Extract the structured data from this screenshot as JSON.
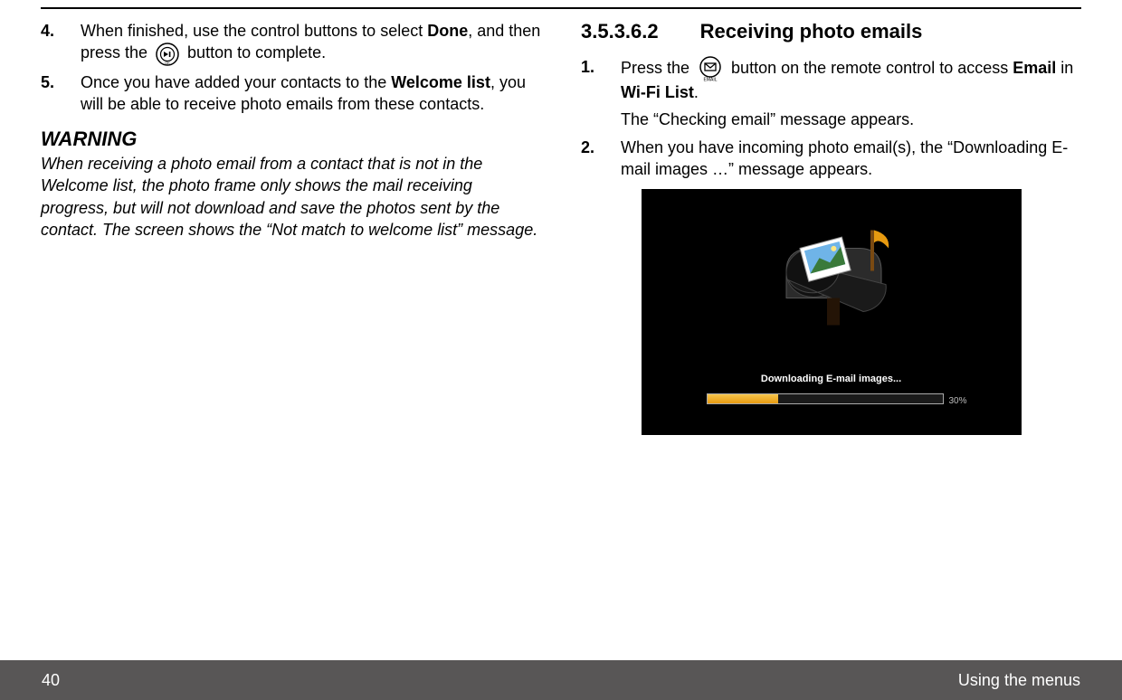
{
  "left": {
    "steps": [
      {
        "num": "4.",
        "pre": "When finished, use the control buttons to select ",
        "bold1": "Done",
        "mid1": ", and then press the ",
        "icon": "ok",
        "post1": " button to complete."
      },
      {
        "num": "5.",
        "pre": "Once you have added your contacts to the ",
        "bold1": "Welcome list",
        "post1": ", you will be able to receive photo emails from these contacts."
      }
    ],
    "warning_head": "WARNING",
    "warning_body": "When receiving a photo email from a contact that is not in the Welcome list, the photo frame only shows the mail receiving progress, but will not download and save the photos sent by the contact. The screen shows the “Not match to welcome list” message."
  },
  "right": {
    "section_num": "3.5.3.6.2",
    "section_title": "Receiving photo emails",
    "steps": [
      {
        "num": "1.",
        "pre": "Press the ",
        "icon": "email",
        "mid1": " button on the remote control to access ",
        "bold1": "Email",
        "mid2": " in ",
        "bold2": "Wi-Fi List",
        "post1": ".",
        "line2": "The “Checking email” message appears."
      },
      {
        "num": "2.",
        "pre": "When you have incoming photo email(s), the “Downloading E-mail images …” message appears."
      }
    ],
    "screenshot": {
      "caption": "Downloading E-mail images...",
      "percent_label": "30%",
      "percent_value": 30
    }
  },
  "footer": {
    "page_num": "40",
    "section": "Using the menus"
  },
  "chart_data": {
    "type": "bar",
    "title": "Downloading E-mail images...",
    "categories": [
      "progress"
    ],
    "values": [
      30
    ],
    "ylim": [
      0,
      100
    ],
    "xlabel": "",
    "ylabel": "%"
  }
}
